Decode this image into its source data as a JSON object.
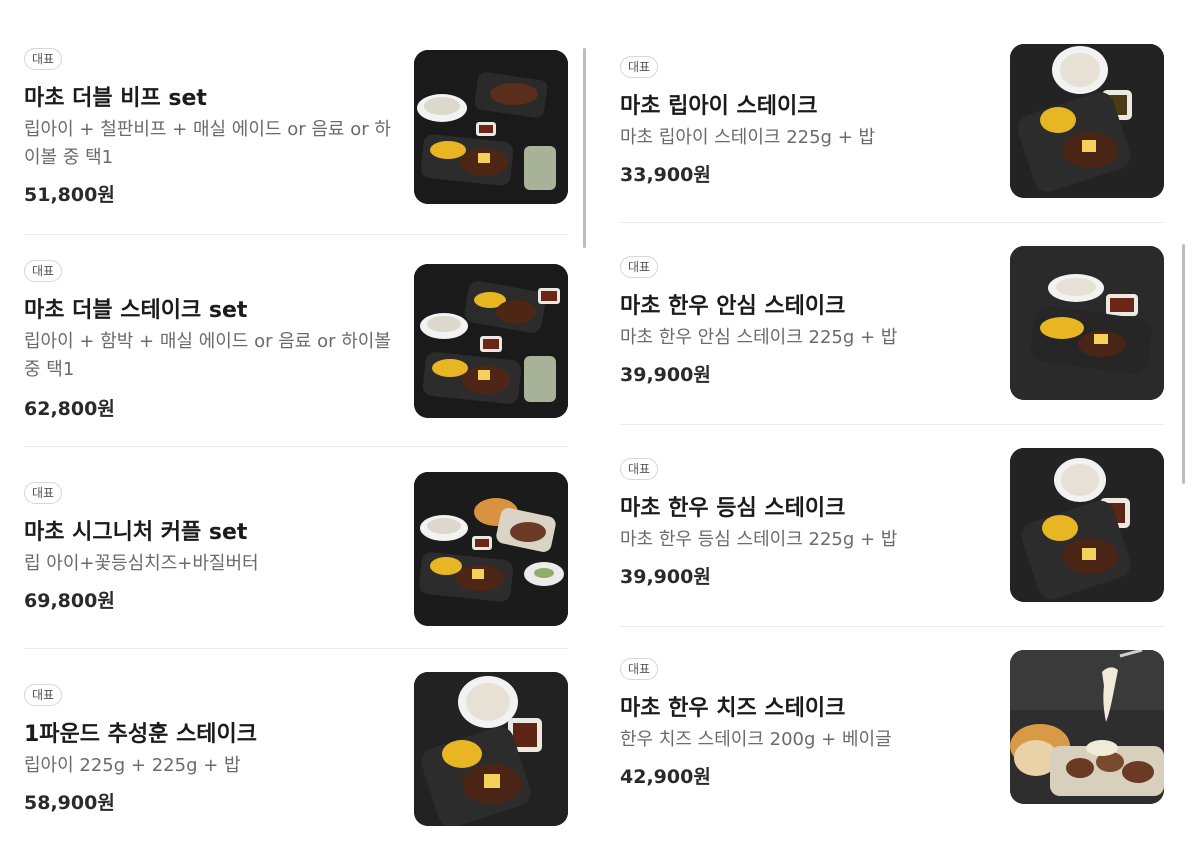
{
  "badge_label": "대표",
  "left_items": [
    {
      "name": "마초 더블 비프 set",
      "desc": "립아이 + 철판비프 + 매실 에이드 or 음료 or 하이볼 중 택1",
      "price": "51,800원",
      "image": "double-beef-set-photo"
    },
    {
      "name": "마초 더블 스테이크 set",
      "desc": "립아이 + 함박 + 매실 에이드 or 음료 or 하이볼 중 택1",
      "price": "62,800원",
      "image": "double-steak-set-photo"
    },
    {
      "name": "마초 시그니처 커플 set",
      "desc": "립 아이+꽃등심치즈+바질버터",
      "price": "69,800원",
      "image": "signature-couple-set-photo"
    },
    {
      "name": "1파운드 추성훈 스테이크",
      "desc": "립아이 225g + 225g + 밥",
      "price": "58,900원",
      "image": "one-pound-steak-photo"
    }
  ],
  "right_items": [
    {
      "name": "마초 립아이 스테이크",
      "desc": "마초 립아이 스테이크 225g + 밥",
      "price": "33,900원",
      "image": "ribeye-steak-photo"
    },
    {
      "name": "마초 한우 안심 스테이크",
      "desc": "마초 한우 안심 스테이크 225g + 밥",
      "price": "39,900원",
      "image": "hanwoo-tenderloin-photo"
    },
    {
      "name": "마초 한우 등심 스테이크",
      "desc": "마초 한우 등심 스테이크 225g + 밥",
      "price": "39,900원",
      "image": "hanwoo-sirloin-photo"
    },
    {
      "name": "마초 한우 치즈 스테이크",
      "desc": "한우 치즈 스테이크 200g + 베이글",
      "price": "42,900원",
      "image": "hanwoo-cheese-steak-photo"
    }
  ],
  "colors": {
    "accent_text": "#1b1b1b",
    "muted_text": "#6b6b6b",
    "divider": "#ececec"
  }
}
